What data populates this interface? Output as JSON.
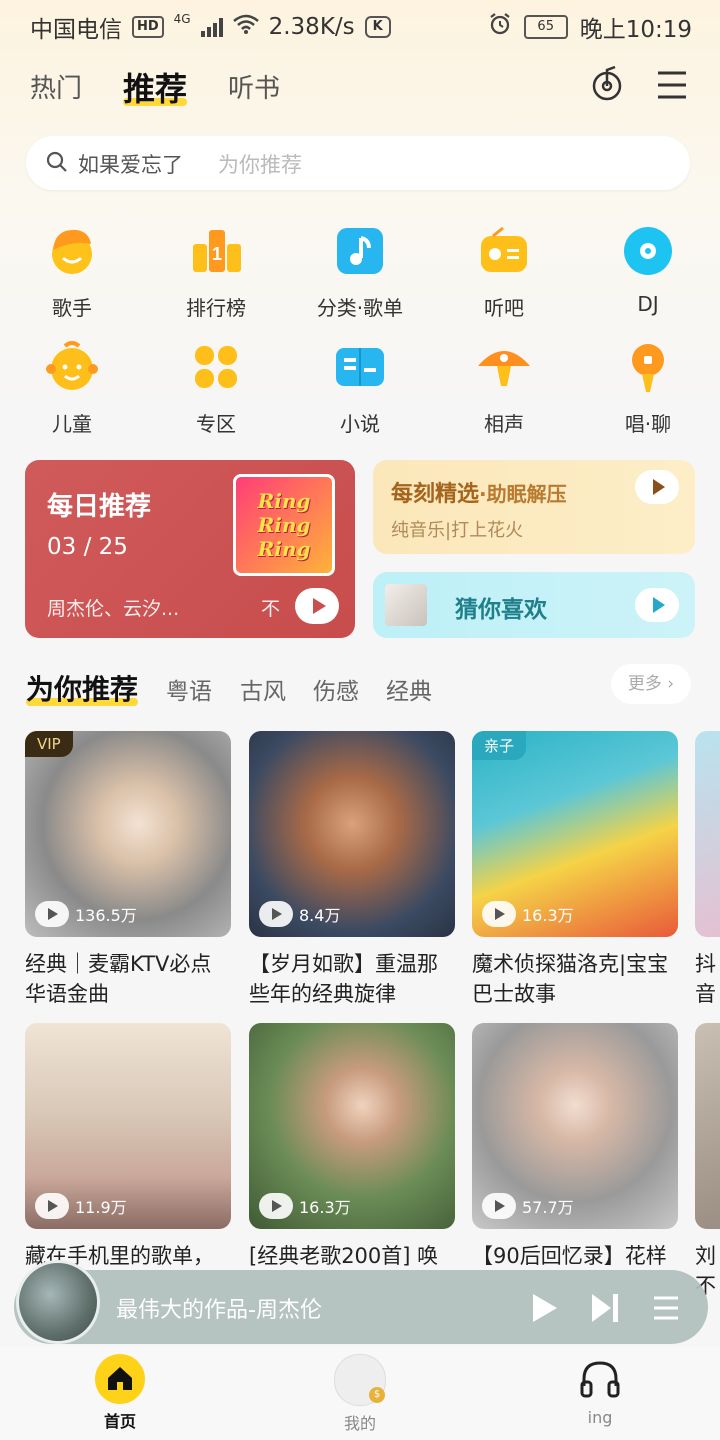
{
  "status_bar": {
    "carrier": "中国电信",
    "hd": "HD",
    "network": "4G",
    "speed": "2.38K/s",
    "battery": "65",
    "time": "晚上10:19"
  },
  "top_tabs": [
    "热门",
    "推荐",
    "听书"
  ],
  "search": {
    "query": "如果爱忘了",
    "hint": "为你推荐"
  },
  "categories": [
    {
      "label": "歌手",
      "icon": "singer-icon",
      "color": "#ffc21a"
    },
    {
      "label": "排行榜",
      "icon": "chart-rank-icon",
      "color": "#ff9a1f"
    },
    {
      "label": "分类·歌单",
      "icon": "music-note-icon",
      "color": "#27b6f0"
    },
    {
      "label": "听吧",
      "icon": "radio-icon",
      "color": "#ffbf1a"
    },
    {
      "label": "DJ",
      "icon": "disc-icon",
      "color": "#1dc4f2"
    },
    {
      "label": "儿童",
      "icon": "child-icon",
      "color": "#ffbf1a"
    },
    {
      "label": "专区",
      "icon": "grid-icon",
      "color": "#ffbf1a"
    },
    {
      "label": "小说",
      "icon": "book-icon",
      "color": "#27b6f0"
    },
    {
      "label": "相声",
      "icon": "crosstalk-icon",
      "color": "#ff8f1f"
    },
    {
      "label": "唱·聊",
      "icon": "microphone-icon",
      "color": "#ff9a1f"
    }
  ],
  "daily": {
    "title": "每日推荐",
    "month": "03",
    "day": "25",
    "artists": "周杰伦、云汐...",
    "right_text": "不",
    "cover_text": "Ring Ring Ring"
  },
  "moment": {
    "title": "每刻精选",
    "tag": "·助眠解压",
    "sub": "纯音乐|打上花火"
  },
  "guess": {
    "title": "猜你喜欢"
  },
  "rec_tabs": [
    "为你推荐",
    "粤语",
    "古风",
    "伤感",
    "经典"
  ],
  "more": "更多",
  "playlists_row1": [
    {
      "title": "经典｜麦霸KTV必点华语金曲",
      "count": "136.5万",
      "badge": "VIP"
    },
    {
      "title": "【岁月如歌】重温那些年的经典旋律",
      "count": "8.4万",
      "badge": ""
    },
    {
      "title": "魔术侦探猫洛克|宝宝巴士故事",
      "count": "16.3万",
      "badge": "亲子"
    },
    {
      "title": "抖音被",
      "count": "",
      "badge": ""
    }
  ],
  "playlists_row2": [
    {
      "title": "藏在手机里的歌单，",
      "count": "11.9万"
    },
    {
      "title": "[经典老歌200首] 唤",
      "count": "16.3万"
    },
    {
      "title": "【90后回忆录】花样",
      "count": "57.7万"
    },
    {
      "title": "刘不",
      "count": ""
    }
  ],
  "mini_player": {
    "song": "最伟大的作品-周杰伦"
  },
  "bottom_nav": [
    {
      "label": "首页"
    },
    {
      "label": "我的"
    },
    {
      "label": "ing"
    }
  ]
}
